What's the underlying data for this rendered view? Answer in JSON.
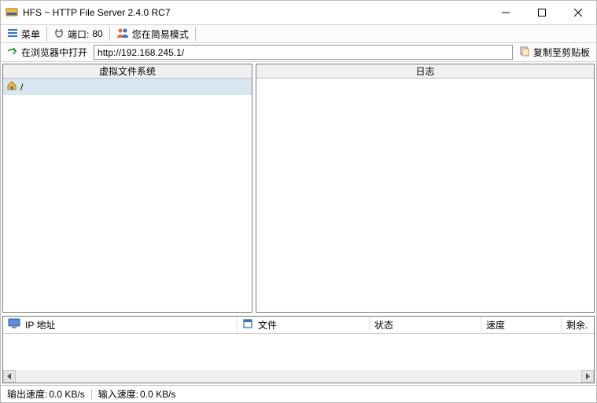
{
  "window": {
    "title": "HFS ~ HTTP File Server 2.4.0 RC7"
  },
  "toolbar": {
    "menu_label": "菜单",
    "port_label": "端口:",
    "port_value": "80",
    "mode_label": "您在简易模式"
  },
  "address_bar": {
    "open_label": "在浏览器中打开",
    "url": "http://192.168.245.1/",
    "copy_label": "复制至剪贴板"
  },
  "panels": {
    "vfs_header": "虚拟文件系统",
    "log_header": "日志",
    "root_path": "/"
  },
  "grid": {
    "columns": {
      "ip": "IP 地址",
      "file": "文件",
      "status": "状态",
      "speed": "速度",
      "remain": "剩余."
    }
  },
  "status": {
    "out_label": "输出速度:",
    "out_value": "0.0 KB/s",
    "in_label": "输入速度:",
    "in_value": "0.0 KB/s"
  }
}
